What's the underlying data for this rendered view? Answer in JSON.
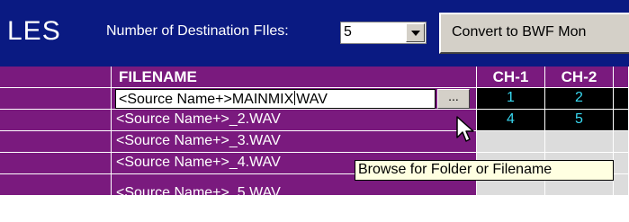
{
  "window": {
    "title": "LES"
  },
  "toolbar": {
    "num_files_label": "Number of Destination FIles:",
    "num_files_value": "5",
    "convert_label": "Convert to BWF Mon"
  },
  "table": {
    "columns": {
      "filename": "FILENAME",
      "ch1": "CH-1",
      "ch2": "CH-2"
    },
    "rows": [
      {
        "filename": "<Source Name+>MAINMIX",
        "filename_after_caret": "WAV",
        "ch1": "1",
        "ch2": "2",
        "editing": true
      },
      {
        "filename": "<Source Name+>_2.WAV",
        "ch1": "4",
        "ch2": "5"
      },
      {
        "filename": "<Source Name+>_3.WAV",
        "ch1": "",
        "ch2": ""
      },
      {
        "filename": "<Source Name+>_4.WAV",
        "ch1": "",
        "ch2": ""
      },
      {
        "filename": "<Source Name+>_5.WAV",
        "ch1": "",
        "ch2": ""
      }
    ],
    "browse_button_label": "..."
  },
  "tooltip": {
    "text": "Browse for Folder or Filename"
  },
  "colors": {
    "header_blue": "#0a1a82",
    "grid_purple": "#7a1a7e",
    "channel_cell_black": "#000000",
    "channel_text_cyan": "#38d8f0",
    "tooltip_bg": "#ffffe1"
  },
  "icons": {
    "combo_arrow": "chevron-down-icon",
    "pointer": "mouse-pointer-icon"
  }
}
